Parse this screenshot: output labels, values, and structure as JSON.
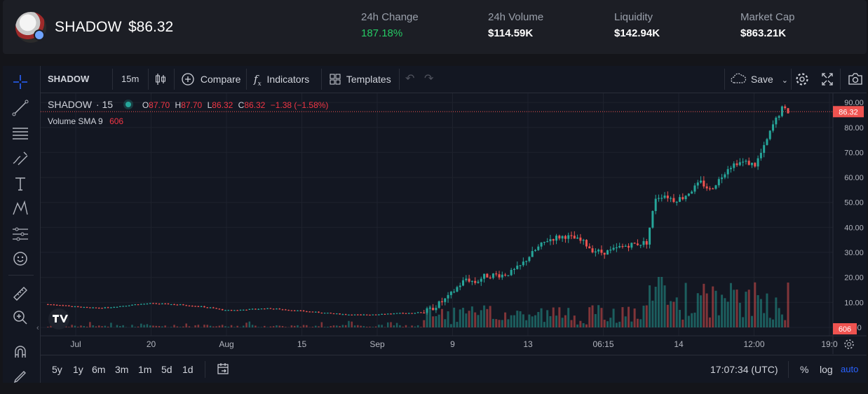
{
  "header": {
    "token_name": "SHADOW",
    "price": "$86.32",
    "stats": [
      {
        "label": "24h Change",
        "value": "187.18%",
        "positive": true
      },
      {
        "label": "24h Volume",
        "value": "$114.59K"
      },
      {
        "label": "Liquidity",
        "value": "$142.94K"
      },
      {
        "label": "Market Cap",
        "value": "$863.21K"
      }
    ]
  },
  "toolbar": {
    "symbol": "SHADOW",
    "interval": "15m",
    "compare": "Compare",
    "indicators": "Indicators",
    "templates": "Templates",
    "save": "Save"
  },
  "legend": {
    "symbol": "SHADOW",
    "interval": "15",
    "o_label": "O",
    "o": "87.70",
    "h_label": "H",
    "h": "87.70",
    "l_label": "L",
    "l": "86.32",
    "c_label": "C",
    "c": "86.32",
    "change": "−1.38 (−1.58%)",
    "volume_label": "Volume SMA 9",
    "volume_value": "606"
  },
  "bottom": {
    "ranges": [
      "5y",
      "1y",
      "6m",
      "3m",
      "1m",
      "5d",
      "1d"
    ],
    "time": "17:07:34 (UTC)",
    "percent": "%",
    "log": "log",
    "auto": "auto"
  },
  "colors": {
    "up": "#26a69a",
    "down": "#ef5350",
    "accent": "#2962ff",
    "positive": "#26c964"
  },
  "chart_data": {
    "type": "candlestick",
    "y_ticks": [
      "90.00",
      "80.00",
      "70.00",
      "60.00",
      "50.00",
      "40.00",
      "30.00",
      "20.00",
      "10.00",
      "0.00"
    ],
    "ylim": [
      0,
      92
    ],
    "x_ticks": [
      "Jul",
      "20",
      "Aug",
      "15",
      "Sep",
      "9",
      "13",
      "06:15",
      "14",
      "12:00",
      "19:0"
    ],
    "last_price_label": "86.32",
    "volume_label": "606",
    "price_path": [
      [
        0,
        9.3
      ],
      [
        5,
        9.0
      ],
      [
        10,
        8.3
      ],
      [
        15,
        7.8
      ],
      [
        20,
        7.9
      ],
      [
        25,
        8.5
      ],
      [
        30,
        9.2
      ],
      [
        35,
        9.6
      ],
      [
        40,
        9.4
      ],
      [
        45,
        9.1
      ],
      [
        50,
        8.6
      ],
      [
        55,
        7.9
      ],
      [
        60,
        6.8
      ],
      [
        65,
        7.0
      ],
      [
        70,
        7.4
      ],
      [
        75,
        7.6
      ],
      [
        80,
        7.1
      ],
      [
        85,
        6.6
      ],
      [
        90,
        6.1
      ],
      [
        95,
        5.6
      ],
      [
        100,
        5.2
      ],
      [
        105,
        5.0
      ],
      [
        110,
        5.3
      ],
      [
        115,
        5.5
      ],
      [
        120,
        5.7
      ],
      [
        125,
        6.0
      ],
      [
        128,
        7.0
      ],
      [
        131,
        9.5
      ],
      [
        134,
        12.0
      ],
      [
        137,
        16.0
      ],
      [
        140,
        19.5
      ],
      [
        143,
        18.0
      ],
      [
        146,
        20.5
      ],
      [
        149,
        21.0
      ],
      [
        152,
        21.0
      ],
      [
        155,
        22.0
      ],
      [
        158,
        24.5
      ],
      [
        161,
        28.5
      ],
      [
        164,
        32.0
      ],
      [
        167,
        35.0
      ],
      [
        170,
        36.0
      ],
      [
        173,
        36.5
      ],
      [
        176,
        35.5
      ],
      [
        179,
        34.0
      ],
      [
        182,
        31.0
      ],
      [
        185,
        30.0
      ],
      [
        188,
        30.5
      ],
      [
        191,
        32.0
      ],
      [
        194,
        33.0
      ],
      [
        197,
        33.5
      ],
      [
        200,
        34.0
      ],
      [
        203,
        52.0
      ],
      [
        206,
        53.0
      ],
      [
        209,
        51.0
      ],
      [
        212,
        52.0
      ],
      [
        215,
        55.0
      ],
      [
        218,
        58.0
      ],
      [
        221,
        55.0
      ],
      [
        224,
        59.0
      ],
      [
        227,
        64.0
      ],
      [
        230,
        66.0
      ],
      [
        233,
        66.0
      ],
      [
        236,
        65.0
      ],
      [
        239,
        72.0
      ],
      [
        242,
        81.0
      ],
      [
        245,
        87.5
      ],
      [
        247,
        86.32
      ]
    ]
  }
}
